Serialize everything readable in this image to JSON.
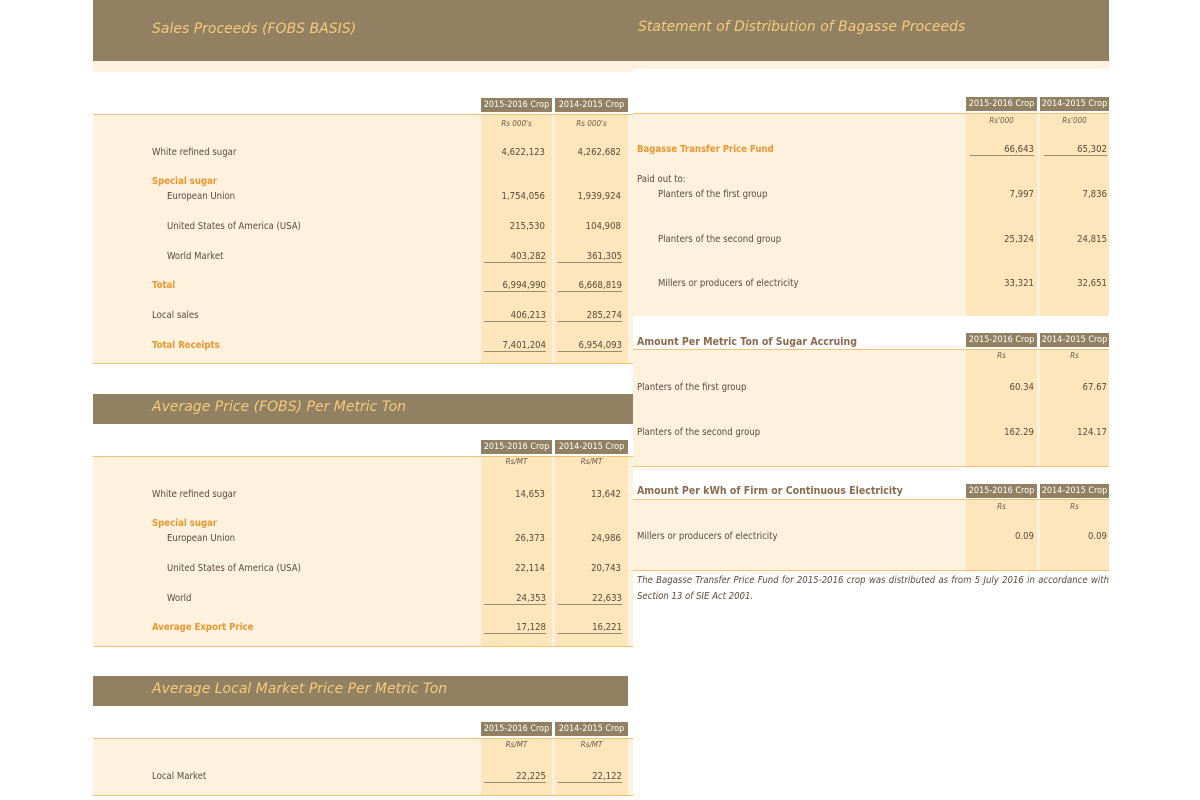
{
  "sales_proceeds": {
    "title": "Sales Proceeds (FOBS BASIS)",
    "col1": "2015-2016 Crop",
    "col2": "2014-2015 Crop",
    "unit": "Rs 000's",
    "rows": {
      "white_refined": {
        "label": "White refined sugar",
        "v1": "4,622,123",
        "v2": "4,262,682"
      },
      "special": {
        "label": "Special sugar"
      },
      "eu": {
        "label": "European Union",
        "v1": "1,754,056",
        "v2": "1,939,924"
      },
      "usa": {
        "label": "United States of America (USA)",
        "v1": "215,530",
        "v2": "104,908"
      },
      "world": {
        "label": "World Market",
        "v1": "403,282",
        "v2": "361,305"
      },
      "total": {
        "label": "Total",
        "v1": "6,994,990",
        "v2": "6,668,819"
      },
      "local": {
        "label": "Local sales",
        "v1": "406,213",
        "v2": "285,274"
      },
      "receipts": {
        "label": "Total Receipts",
        "v1": "7,401,204",
        "v2": "6,954,093"
      }
    }
  },
  "avg_price": {
    "title": "Average Price (FOBS) Per Metric Ton",
    "col1": "2015-2016 Crop",
    "col2": "2014-2015 Crop",
    "unit": "Rs/MT",
    "rows": {
      "white_refined": {
        "label": "White refined sugar",
        "v1": "14,653",
        "v2": "13,642"
      },
      "special": {
        "label": "Special sugar"
      },
      "eu": {
        "label": "European Union",
        "v1": "26,373",
        "v2": "24,986"
      },
      "usa": {
        "label": "United States of America (USA)",
        "v1": "22,114",
        "v2": "20,743"
      },
      "world": {
        "label": "World",
        "v1": "24,353",
        "v2": "22,633"
      },
      "export": {
        "label": "Average Export Price",
        "v1": "17,128",
        "v2": "16,221"
      }
    }
  },
  "local_price": {
    "title": "Average Local Market Price Per Metric Ton",
    "col1": "2015-2016 Crop",
    "col2": "2014-2015 Crop",
    "unit": "Rs/MT",
    "rows": {
      "local": {
        "label": "Local Market",
        "v1": "22,225",
        "v2": "22,122"
      }
    }
  },
  "bagasse": {
    "title": "Statement of Distribution of Bagasse Proceeds",
    "col1": "2015-2016 Crop",
    "col2": "2014-2015 Crop",
    "unit": "Rs'000",
    "rows": {
      "fund": {
        "label": "Bagasse Transfer Price Fund",
        "v1": "66,643",
        "v2": "65,302"
      },
      "paid": {
        "label": "Paid out to:"
      },
      "first": {
        "label": "Planters of the first group",
        "v1": "7,997",
        "v2": "7,836"
      },
      "second": {
        "label": "Planters of the second group",
        "v1": "25,324",
        "v2": "24,815"
      },
      "millers": {
        "label": "Millers or producers of electricity",
        "v1": "33,321",
        "v2": "32,651"
      }
    }
  },
  "per_ton": {
    "title": "Amount Per Metric Ton of Sugar Accruing",
    "col1": "2015-2016 Crop",
    "col2": "2014-2015 Crop",
    "unit": "Rs",
    "rows": {
      "first": {
        "label": "Planters of the first group",
        "v1": "60.34",
        "v2": "67.67"
      },
      "second": {
        "label": "Planters of the second group",
        "v1": "162.29",
        "v2": "124.17"
      }
    }
  },
  "per_kwh": {
    "title": "Amount Per kWh of Firm or Continuous Electricity",
    "col1": "2015-2016 Crop",
    "col2": "2014-2015 Crop",
    "unit": "Rs",
    "rows": {
      "millers": {
        "label": "Millers or producers of electricity",
        "v1": "0.09",
        "v2": "0.09"
      }
    }
  },
  "note": "The Bagasse Transfer Price Fund for 2015-2016 crop was distributed as from 5 July 2016 in accordance with Section 13 of SIE Act 2001."
}
